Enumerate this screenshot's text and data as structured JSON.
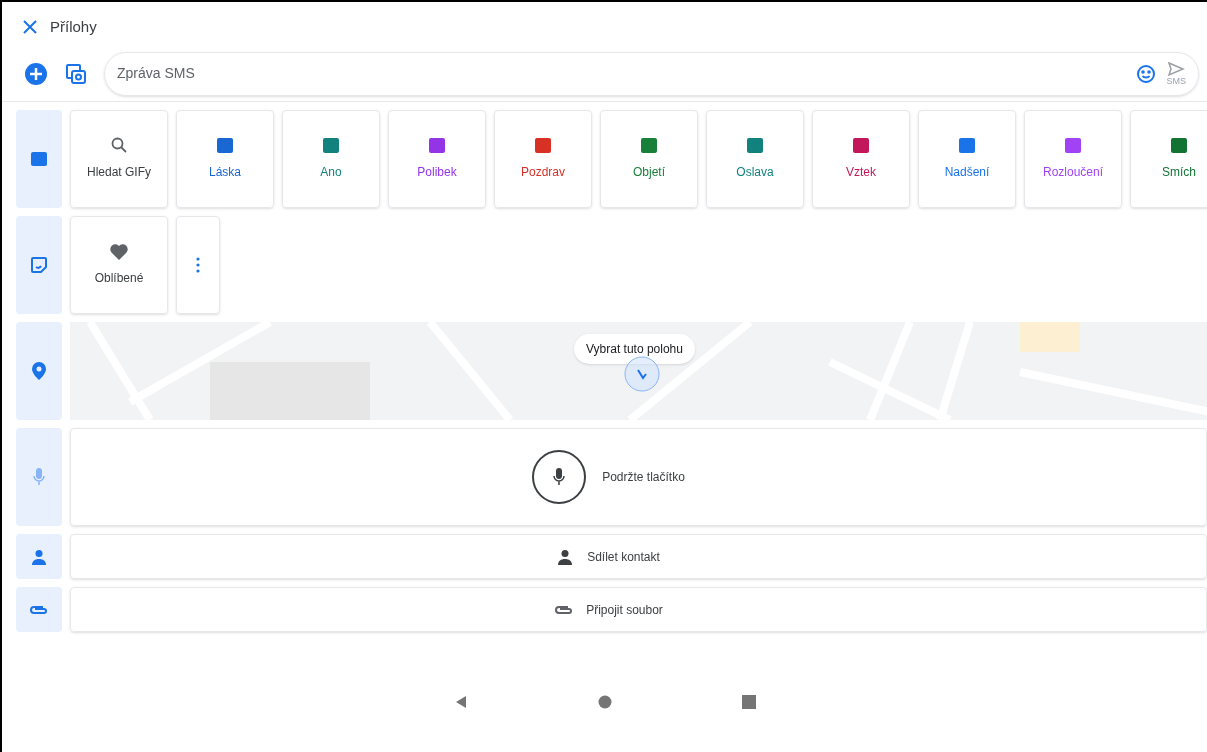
{
  "header": {
    "title": "Přílohy"
  },
  "compose": {
    "placeholder": "Zpráva SMS",
    "send_label": "SMS"
  },
  "gif_search": {
    "label": "Hledat GIFy"
  },
  "gif_categories": [
    {
      "label": "Láska",
      "color": "#1967d2"
    },
    {
      "label": "Ano",
      "color": "#12827f"
    },
    {
      "label": "Polibek",
      "color": "#9334e6"
    },
    {
      "label": "Pozdrav",
      "color": "#d93025"
    },
    {
      "label": "Objetí",
      "color": "#188038"
    },
    {
      "label": "Oslava",
      "color": "#12827f"
    },
    {
      "label": "Vztek",
      "color": "#c2185b"
    },
    {
      "label": "Nadšení",
      "color": "#1a73e8"
    },
    {
      "label": "Rozloučení",
      "color": "#a142f4"
    },
    {
      "label": "Smích",
      "color": "#137333"
    }
  ],
  "stickers": {
    "favorites_label": "Oblíbené"
  },
  "location": {
    "button": "Vybrat tuto polohu"
  },
  "voice": {
    "label": "Podržte tlačítko"
  },
  "contact": {
    "label": "Sdílet kontakt"
  },
  "file": {
    "label": "Připojit soubor"
  }
}
